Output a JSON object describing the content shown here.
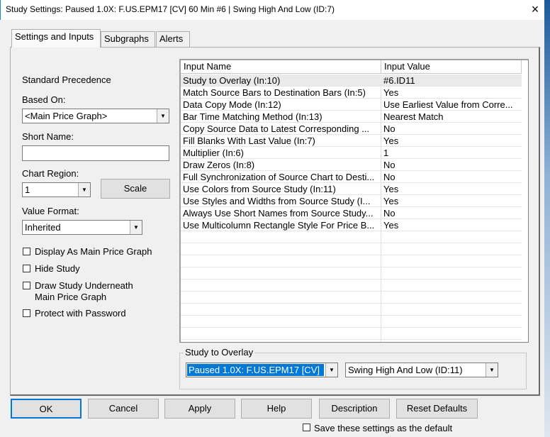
{
  "window": {
    "title": "Study Settings: Paused 1.0X: F.US.EPM17 [CV]  60 Min   #6 | Swing High And Low (ID:7)",
    "close_icon": "×"
  },
  "tabs": [
    "Settings and Inputs",
    "Subgraphs",
    "Alerts"
  ],
  "left": {
    "standard_precedence": "Standard Precedence",
    "based_on_label": "Based On:",
    "based_on_value": "<Main Price Graph>",
    "short_name_label": "Short Name:",
    "short_name_value": "",
    "chart_region_label": "Chart Region:",
    "chart_region_value": "1",
    "scale_button": "Scale",
    "value_format_label": "Value Format:",
    "value_format_value": "Inherited",
    "checkboxes": [
      {
        "label": "Display As Main Price Graph",
        "checked": false
      },
      {
        "label": "Hide Study",
        "checked": false
      },
      {
        "label": "Draw Study Underneath",
        "label2": "Main Price Graph",
        "checked": false
      },
      {
        "label": "Protect with Password",
        "checked": false
      }
    ]
  },
  "table": {
    "headers": [
      "Input Name",
      "Input Value"
    ],
    "rows": [
      {
        "name": "Study to Overlay   (In:10)",
        "value": "#6.ID11"
      },
      {
        "name": "Match Source Bars to Destination Bars   (In:5)",
        "value": "Yes"
      },
      {
        "name": "Data Copy Mode   (In:12)",
        "value": "Use Earliest Value from Corre..."
      },
      {
        "name": "Bar Time Matching Method   (In:13)",
        "value": "Nearest Match"
      },
      {
        "name": "Copy Source Data to Latest Corresponding ...",
        "value": "No"
      },
      {
        "name": "Fill Blanks With Last Value   (In:7)",
        "value": "Yes"
      },
      {
        "name": "Multiplier   (In:6)",
        "value": "1"
      },
      {
        "name": "Draw Zeros   (In:8)",
        "value": "No"
      },
      {
        "name": "Full Synchronization of Source Chart to Desti...",
        "value": "No"
      },
      {
        "name": "Use Colors from Source Study   (In:11)",
        "value": "Yes"
      },
      {
        "name": "Use Styles and Widths from Source Study   (I...",
        "value": "Yes"
      },
      {
        "name": "Always Use Short Names from Source Study...",
        "value": "No"
      },
      {
        "name": "Use Multicolumn Rectangle Style For Price B...",
        "value": "Yes"
      }
    ]
  },
  "overlay": {
    "label": "Study to Overlay",
    "chart_value": "Paused 1.0X: F.US.EPM17 [CV]",
    "study_value": "Swing High And Low (ID:11)"
  },
  "buttons": [
    "OK",
    "Cancel",
    "Apply",
    "Help",
    "Description",
    "Reset Defaults"
  ],
  "save_default": {
    "label": "Save these settings as the default",
    "checked": false
  },
  "colors": {
    "selection": "#0078d7"
  }
}
